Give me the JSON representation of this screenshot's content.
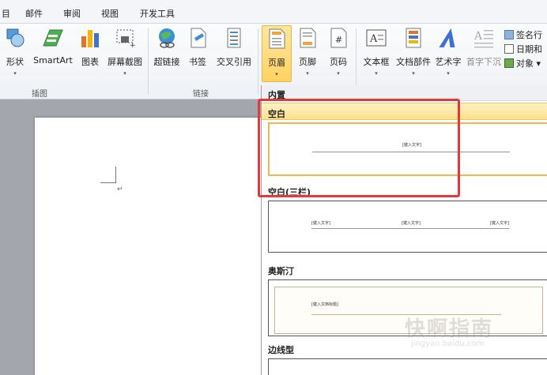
{
  "menu": [
    "目",
    "邮件",
    "审阅",
    "视图",
    "开发工具"
  ],
  "ribbon": {
    "buttons": [
      {
        "label": "形状",
        "icon": "shapes-icon"
      },
      {
        "label": "SmartArt",
        "icon": "smartart-icon"
      },
      {
        "label": "图表",
        "icon": "chart-icon"
      },
      {
        "label": "屏幕截图",
        "icon": "screenshot-icon"
      },
      {
        "label": "超链接",
        "icon": "hyperlink-icon"
      },
      {
        "label": "书签",
        "icon": "bookmark-icon"
      },
      {
        "label": "交叉引用",
        "icon": "cross-reference-icon"
      },
      {
        "label": "页眉",
        "icon": "header-icon"
      },
      {
        "label": "页脚",
        "icon": "footer-icon"
      },
      {
        "label": "页码",
        "icon": "page-number-icon"
      },
      {
        "label": "文本框",
        "icon": "textbox-icon"
      },
      {
        "label": "文档部件",
        "icon": "quick-parts-icon"
      },
      {
        "label": "艺术字",
        "icon": "wordart-icon"
      },
      {
        "label": "首字下沉",
        "icon": "drop-cap-icon"
      }
    ],
    "small_buttons": [
      "签名行",
      "日期和",
      "对象"
    ],
    "groups": [
      "插图",
      "链接"
    ]
  },
  "gallery": {
    "section": "内置",
    "items": [
      {
        "name": "空白",
        "placeholders": [
          "[键入文字]"
        ]
      },
      {
        "name": "空白(三栏)",
        "placeholders": [
          "[键入文字]",
          "[键入文字]",
          "[键入文字]"
        ]
      },
      {
        "name": "奥斯汀",
        "placeholders": [
          "[键入文档标题]"
        ]
      },
      {
        "name": "边线型",
        "placeholders": []
      }
    ]
  },
  "watermark": {
    "text": "快啊指南",
    "sub": "jingyan.baidu.com"
  },
  "colors": {
    "selected": "#ffd261",
    "highlight_border": "#e23a3a",
    "accent": "#f0b64d"
  }
}
